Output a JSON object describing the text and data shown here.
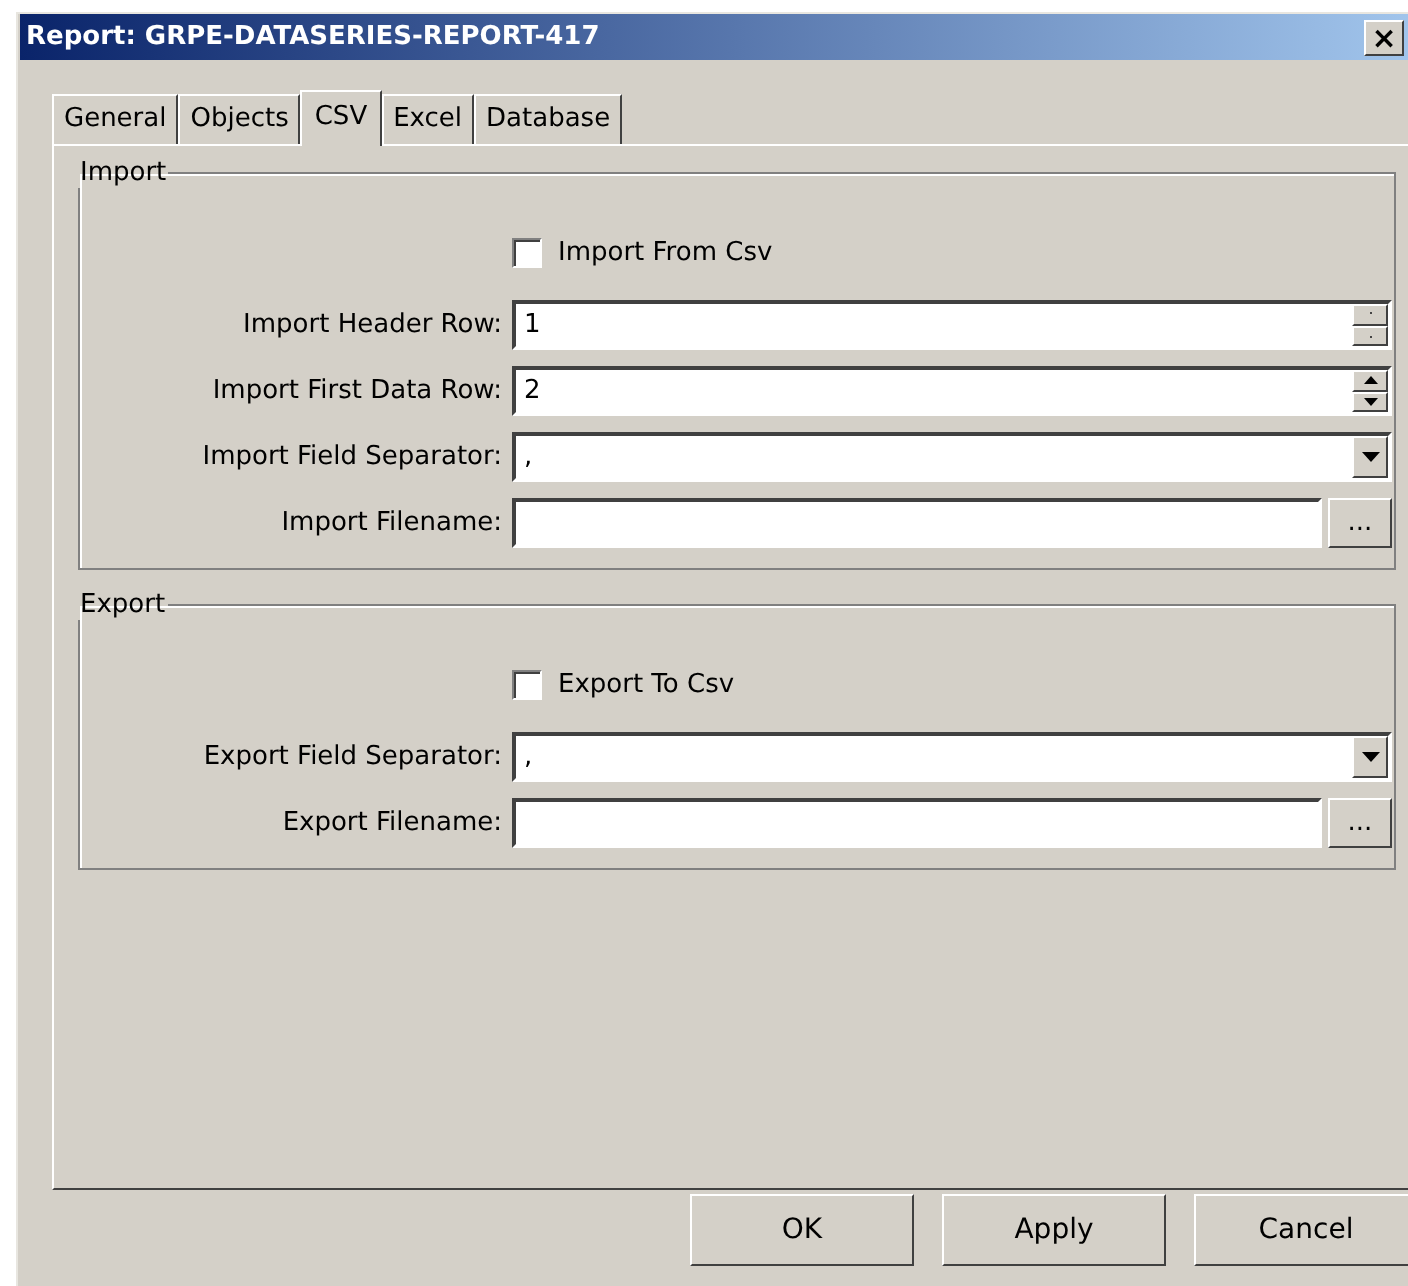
{
  "window": {
    "title": "Report: GRPE-DATASERIES-REPORT-417",
    "close": "×"
  },
  "tabs": [
    {
      "label": "General",
      "selected": false
    },
    {
      "label": "Objects",
      "selected": false
    },
    {
      "label": "CSV",
      "selected": true
    },
    {
      "label": "Excel",
      "selected": false
    },
    {
      "label": "Database",
      "selected": false
    }
  ],
  "groups": [
    {
      "title": "Import",
      "rows": [
        {
          "kind": "check",
          "label": "Import From Csv",
          "checked": false
        },
        {
          "kind": "spin",
          "label": "Import Header Row:",
          "value": "1",
          "disabled": true
        },
        {
          "kind": "spin",
          "label": "Import First Data Row:",
          "value": "2",
          "disabled": false
        },
        {
          "kind": "combo",
          "label": "Import Field Separator:",
          "value": ","
        },
        {
          "kind": "file",
          "label": "Import Filename:",
          "button": "..."
        }
      ]
    },
    {
      "title": "Export",
      "rows": [
        {
          "kind": "check",
          "label": "Export To Csv",
          "checked": false
        },
        {
          "kind": "combo",
          "label": "Export Field Separator:",
          "value": ","
        },
        {
          "kind": "file",
          "label": "Export Filename:",
          "button": "..."
        }
      ]
    }
  ],
  "buttons": [
    "OK",
    "Apply",
    "Cancel"
  ]
}
